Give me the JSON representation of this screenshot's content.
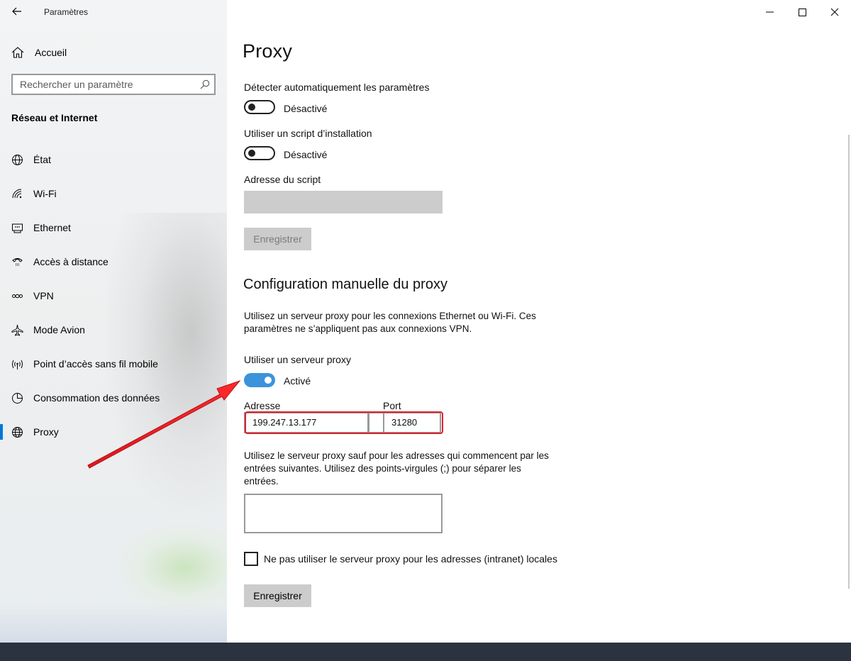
{
  "window": {
    "app_title": "Paramètres",
    "controls": {
      "minimize": "minimize-icon",
      "maximize": "maximize-icon",
      "close": "close-icon"
    }
  },
  "sidebar": {
    "home_label": "Accueil",
    "search_placeholder": "Rechercher un paramètre",
    "section_title": "Réseau et Internet",
    "items": [
      {
        "label": "État",
        "icon": "globe-status-icon"
      },
      {
        "label": "Wi-Fi",
        "icon": "wifi-icon"
      },
      {
        "label": "Ethernet",
        "icon": "ethernet-icon"
      },
      {
        "label": "Accès à distance",
        "icon": "dialup-icon"
      },
      {
        "label": "VPN",
        "icon": "vpn-icon"
      },
      {
        "label": "Mode Avion",
        "icon": "airplane-icon"
      },
      {
        "label": "Point d’accès sans fil mobile",
        "icon": "hotspot-icon"
      },
      {
        "label": "Consommation des données",
        "icon": "data-usage-icon"
      },
      {
        "label": "Proxy",
        "icon": "globe-icon",
        "active": true
      }
    ]
  },
  "main": {
    "title": "Proxy",
    "auto_detect": {
      "label": "Détecter automatiquement les paramètres",
      "state": "Désactivé",
      "on": false
    },
    "setup_script": {
      "label": "Utiliser un script d’installation",
      "state": "Désactivé",
      "on": false
    },
    "script_address": {
      "label": "Adresse du script",
      "value": ""
    },
    "save_button_disabled": "Enregistrer",
    "manual_section": {
      "title": "Configuration manuelle du proxy",
      "description_line1": "Utilisez un serveur proxy pour les connexions Ethernet ou Wi-Fi. Ces",
      "description_line2": "paramètres ne s’appliquent pas aux connexions VPN.",
      "use_proxy": {
        "label": "Utiliser un serveur proxy",
        "state": "Activé",
        "on": true
      },
      "address_label": "Adresse",
      "address_value": "199.247.13.177",
      "port_label": "Port",
      "port_value": "31280",
      "exceptions_line1": "Utilisez le serveur proxy sauf pour les adresses qui commencent par les",
      "exceptions_line2": "entrées suivantes. Utilisez des points-virgules (;) pour séparer les",
      "exceptions_line3": "entrées.",
      "exceptions_value": "",
      "local_checkbox_label": "Ne pas utiliser le serveur proxy pour les adresses (intranet) locales",
      "local_checked": false,
      "save_button": "Enregistrer"
    }
  },
  "annotation": {
    "highlight_color": "#e0202a",
    "arrow_color": "#e0202a"
  },
  "colors": {
    "accent": "#0078d7",
    "toggle_on": "#3b93dc"
  }
}
